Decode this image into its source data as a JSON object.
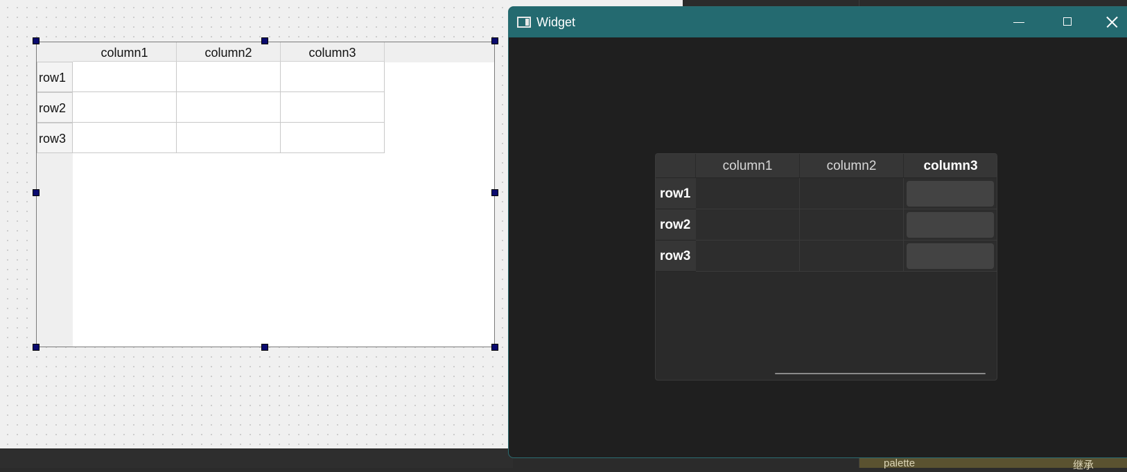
{
  "designer": {
    "table": {
      "columns": [
        "column1",
        "column2",
        "column3"
      ],
      "rows": [
        "row1",
        "row2",
        "row3"
      ]
    }
  },
  "window": {
    "title": "Widget",
    "table": {
      "columns": [
        "column1",
        "column2",
        "column3"
      ],
      "rows": [
        "row1",
        "row2",
        "row3"
      ],
      "selected_column": "column3"
    }
  },
  "background": {
    "bottom_labels": [
      "palette",
      "继承"
    ]
  },
  "colors": {
    "titlebar": "#246a70",
    "window_bg": "#1f1f1f",
    "selection_handle": "#0a0a6e"
  }
}
